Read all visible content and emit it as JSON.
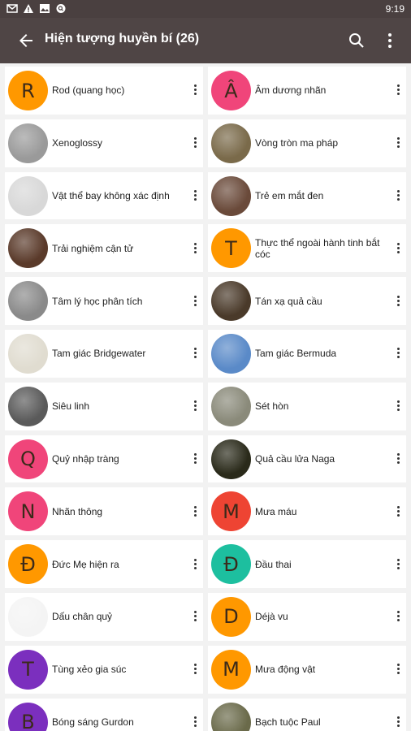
{
  "status_bar": {
    "time": "9:19",
    "icons": [
      "gmail-icon",
      "warning-icon",
      "image-icon",
      "search-notification-icon"
    ]
  },
  "app_bar": {
    "title": "Hiện tượng huyền bí (26)",
    "back_icon": "arrow-back-icon",
    "search_icon": "search-icon",
    "more_icon": "more-vert-icon"
  },
  "items": [
    {
      "label": "Rod (quang học)",
      "avatar": {
        "type": "letter",
        "letter": "R",
        "color": "#FF9800"
      }
    },
    {
      "label": "Âm dương nhãn",
      "avatar": {
        "type": "letter",
        "letter": "Â",
        "color": "#F0457A"
      }
    },
    {
      "label": "Xenoglossy",
      "avatar": {
        "type": "photo",
        "name": "portrait-bearded-man-photo",
        "color": "#9a9a9a"
      }
    },
    {
      "label": "Vòng tròn ma pháp",
      "avatar": {
        "type": "photo",
        "name": "magic-circle-photo",
        "color": "#7a6a4a"
      }
    },
    {
      "label": "Vật thể bay không xác định",
      "avatar": {
        "type": "photo",
        "name": "ufo-photo",
        "color": "#d8d8d8"
      }
    },
    {
      "label": "Trẻ em mắt đen",
      "avatar": {
        "type": "photo",
        "name": "child-face-photo",
        "color": "#6a4a3a"
      }
    },
    {
      "label": "Trải nghiệm cận tử",
      "avatar": {
        "type": "photo",
        "name": "tunnel-painting-photo",
        "color": "#5a3a2a"
      }
    },
    {
      "label": "Thực thể ngoài hành tinh bắt cóc",
      "avatar": {
        "type": "letter",
        "letter": "T",
        "color": "#FF9800"
      }
    },
    {
      "label": "Tâm lý học phân tích",
      "avatar": {
        "type": "photo",
        "name": "portrait-old-man-photo",
        "color": "#8a8a8a"
      }
    },
    {
      "label": "Tán xạ quả cầu",
      "avatar": {
        "type": "photo",
        "name": "orb-photo",
        "color": "#4a3a2a"
      }
    },
    {
      "label": "Tam giác Bridgewater",
      "avatar": {
        "type": "photo",
        "name": "map-bridgewater-photo",
        "color": "#e0dcd0"
      }
    },
    {
      "label": "Tam giác Bermuda",
      "avatar": {
        "type": "photo",
        "name": "map-bermuda-photo",
        "color": "#5a8ac8"
      }
    },
    {
      "label": "Siêu linh",
      "avatar": {
        "type": "photo",
        "name": "seance-photo",
        "color": "#5a5a5a"
      }
    },
    {
      "label": "Sét hòn",
      "avatar": {
        "type": "photo",
        "name": "ball-lightning-engraving-photo",
        "color": "#8a8a7a"
      }
    },
    {
      "label": "Quỷ nhập tràng",
      "avatar": {
        "type": "letter",
        "letter": "Q",
        "color": "#F0457A"
      }
    },
    {
      "label": "Quả cầu lửa Naga",
      "avatar": {
        "type": "photo",
        "name": "naga-fireballs-photo",
        "color": "#2a2a1a"
      }
    },
    {
      "label": "Nhãn thông",
      "avatar": {
        "type": "letter",
        "letter": "N",
        "color": "#F0457A"
      }
    },
    {
      "label": "Mưa máu",
      "avatar": {
        "type": "letter",
        "letter": "M",
        "color": "#EE4433"
      }
    },
    {
      "label": "Đức Mẹ hiện ra",
      "avatar": {
        "type": "letter",
        "letter": "Đ",
        "color": "#FF9800"
      }
    },
    {
      "label": "Đầu thai",
      "avatar": {
        "type": "letter",
        "letter": "Đ",
        "color": "#1DBF9F"
      }
    },
    {
      "label": "Dấu chân quỷ",
      "avatar": {
        "type": "photo",
        "name": "footprints-sketch-photo",
        "color": "#f4f4f4"
      }
    },
    {
      "label": "Déjà vu",
      "avatar": {
        "type": "letter",
        "letter": "D",
        "color": "#FF9800"
      }
    },
    {
      "label": "Tùng xẻo gia súc",
      "avatar": {
        "type": "letter",
        "letter": "T",
        "color": "#7B2FBE"
      }
    },
    {
      "label": "Mưa động vật",
      "avatar": {
        "type": "letter",
        "letter": "M",
        "color": "#FF9800"
      }
    },
    {
      "label": "Bóng sáng Gurdon",
      "avatar": {
        "type": "letter",
        "letter": "B",
        "color": "#7B2FBE"
      }
    },
    {
      "label": "Bạch tuộc Paul",
      "avatar": {
        "type": "photo",
        "name": "octopus-photo",
        "color": "#6a6a4a"
      }
    }
  ]
}
